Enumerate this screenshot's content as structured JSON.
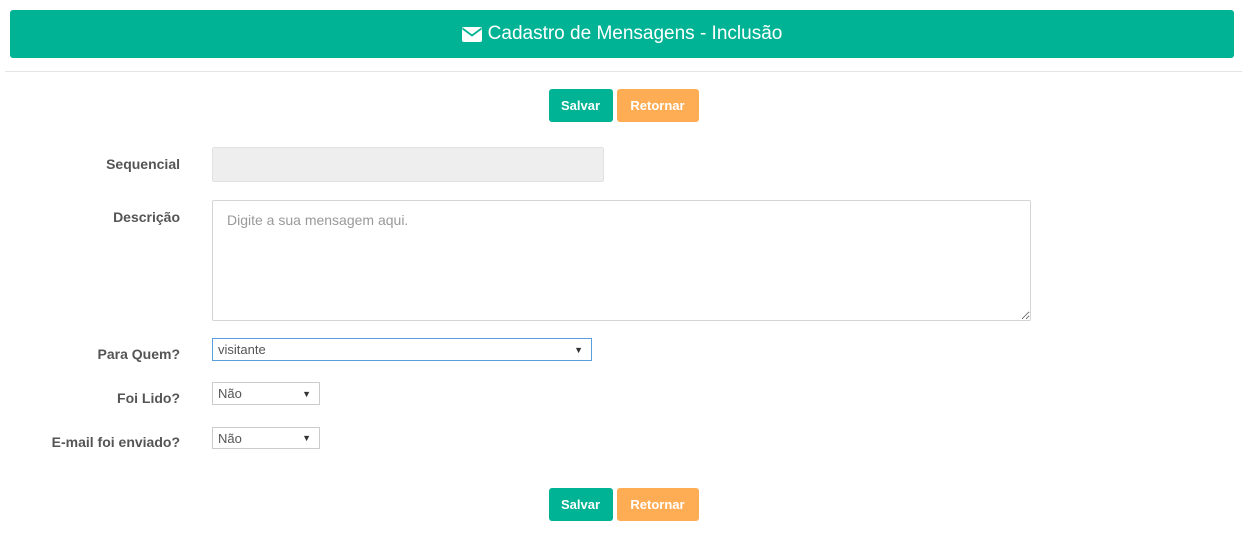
{
  "header": {
    "title": "Cadastro de Mensagens - Inclusão",
    "icon": "envelope-icon",
    "background": "#00b394"
  },
  "actions": {
    "save_label": "Salvar",
    "back_label": "Retornar",
    "save_color": "#00b394",
    "back_color": "#ffad55"
  },
  "form": {
    "sequencial": {
      "label": "Sequencial",
      "value": ""
    },
    "descricao": {
      "label": "Descrição",
      "placeholder": "Digite a sua mensagem aqui."
    },
    "para_quem": {
      "label": "Para Quem?",
      "value": "visitante"
    },
    "foi_lido": {
      "label": "Foi Lido?",
      "value": "Não"
    },
    "email_enviado": {
      "label": "E-mail foi enviado?",
      "value": "Não"
    }
  }
}
